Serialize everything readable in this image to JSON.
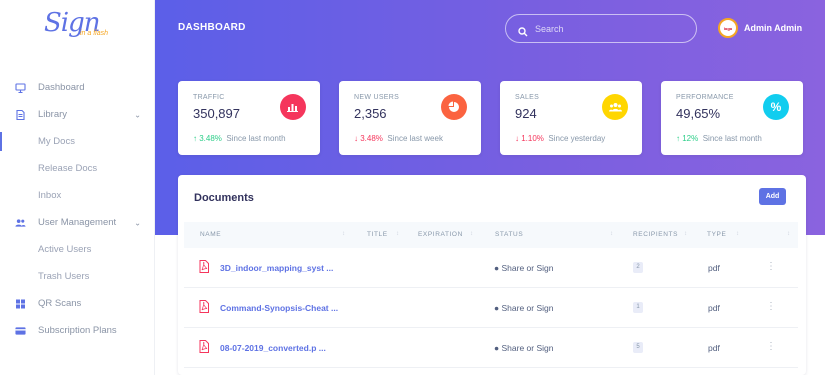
{
  "brand": {
    "logo_text": "Sign",
    "logo_sub": "in a flash"
  },
  "sidebar": {
    "items": [
      {
        "label": "Dashboard",
        "icon": "monitor-icon"
      },
      {
        "label": "Library",
        "icon": "document-icon",
        "expandable": true
      },
      {
        "label": "My Docs",
        "active": true
      },
      {
        "label": "Release Docs"
      },
      {
        "label": "Inbox"
      },
      {
        "label": "User Management",
        "icon": "users-icon",
        "expandable": true
      },
      {
        "label": "Active Users"
      },
      {
        "label": "Trash Users"
      },
      {
        "label": "QR Scans",
        "icon": "grid-icon"
      },
      {
        "label": "Subscription Plans",
        "icon": "card-icon"
      }
    ]
  },
  "header": {
    "title": "DASHBOARD",
    "search_placeholder": "Search",
    "user_name": "Admin Admin",
    "avatar_text": "logo"
  },
  "stats": [
    {
      "title": "TRAFFIC",
      "value": "350,897",
      "change": "3.48%",
      "direction": "up",
      "period": "Since last month",
      "color": "#f5365c",
      "icon": "chart-bar-icon",
      "glyph": "▆"
    },
    {
      "title": "NEW USERS",
      "value": "2,356",
      "change": "3.48%",
      "direction": "down",
      "period": "Since last week",
      "color": "#fb6340",
      "icon": "chart-pie-icon",
      "glyph": "◕"
    },
    {
      "title": "SALES",
      "value": "924",
      "change": "1.10%",
      "direction": "down",
      "period": "Since yesterday",
      "color": "#ffd600",
      "icon": "users-icon",
      "glyph": "❂"
    },
    {
      "title": "PERFORMANCE",
      "value": "49,65%",
      "change": "12%",
      "direction": "up",
      "period": "Since last month",
      "color": "#11cdef",
      "icon": "percent-icon",
      "glyph": "%"
    }
  ],
  "documents": {
    "title": "Documents",
    "add_label": "Add",
    "columns": [
      "NAME",
      "TITLE",
      "EXPIRATION",
      "STATUS",
      "RECIPIENTS",
      "TYPE"
    ],
    "rows": [
      {
        "name": "3D_indoor_mapping_syst ...",
        "status": "Share or Sign",
        "recipients": "2",
        "type": "pdf"
      },
      {
        "name": "Command-Synopsis-Cheat ...",
        "status": "Share or Sign",
        "recipients": "1",
        "type": "pdf"
      },
      {
        "name": "08-07-2019_converted.p ...",
        "status": "Share or Sign",
        "recipients": "5",
        "type": "pdf"
      }
    ]
  }
}
